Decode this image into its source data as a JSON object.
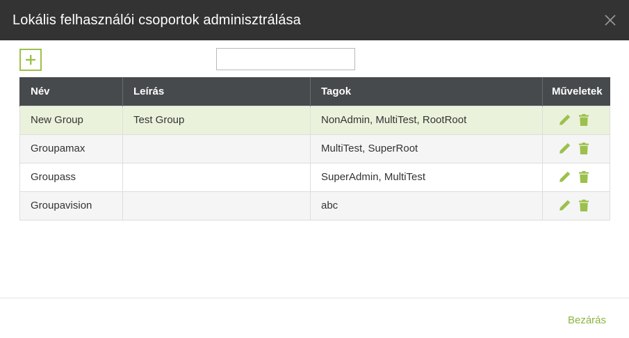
{
  "dialog": {
    "title": "Lokális felhasználói csoportok adminisztrálása",
    "close_icon": "close-icon"
  },
  "toolbar": {
    "add_icon": "plus-icon",
    "search": {
      "value": "",
      "placeholder": "",
      "icon": "search-icon"
    }
  },
  "table": {
    "columns": [
      "Név",
      "Leírás",
      "Tagok",
      "Műveletek"
    ],
    "rows": [
      {
        "name": "New Group",
        "description": "Test Group",
        "members": "NonAdmin, MultiTest, RootRoot",
        "selected": true
      },
      {
        "name": "Groupamax",
        "description": "",
        "members": "MultiTest, SuperRoot",
        "selected": false
      },
      {
        "name": "Groupass",
        "description": "",
        "members": "SuperAdmin, MultiTest",
        "selected": false
      },
      {
        "name": "Groupavision",
        "description": "",
        "members": "abc",
        "selected": false
      }
    ],
    "row_actions": [
      "edit-icon",
      "delete-icon"
    ]
  },
  "footer": {
    "close_label": "Bezárás"
  },
  "colors": {
    "accent": "#9cc04c",
    "header_bg": "#333333",
    "table_header_bg": "#474a4c",
    "selected_row_bg": "#ebf2dc"
  }
}
